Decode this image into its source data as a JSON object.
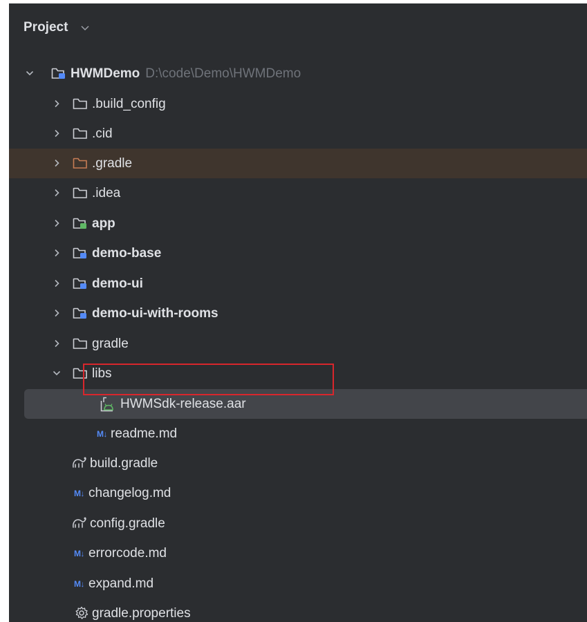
{
  "header": {
    "title": "Project"
  },
  "tree": {
    "root": {
      "name": "HWMDemo",
      "path": "D:\\code\\Demo\\HWMDemo"
    },
    "items": [
      {
        "label": ".build_config"
      },
      {
        "label": ".cid"
      },
      {
        "label": ".gradle"
      },
      {
        "label": ".idea"
      },
      {
        "label": "app"
      },
      {
        "label": "demo-base"
      },
      {
        "label": "demo-ui"
      },
      {
        "label": "demo-ui-with-rooms"
      },
      {
        "label": "gradle"
      },
      {
        "label": "libs"
      },
      {
        "label": "HWMSdk-release.aar"
      },
      {
        "label": "readme.md"
      },
      {
        "label": "build.gradle"
      },
      {
        "label": "changelog.md"
      },
      {
        "label": "config.gradle"
      },
      {
        "label": "errorcode.md"
      },
      {
        "label": "expand.md"
      },
      {
        "label": "gradle.properties"
      }
    ]
  },
  "icons": {
    "markdown_glyph": "M↓",
    "folder_color": "#ced0d6",
    "excluded_folder_color": "#c77d55",
    "module_badge_color": "#548af7",
    "app_badge_color": "#5fb865",
    "highlight_box_color": "#d9262c"
  }
}
